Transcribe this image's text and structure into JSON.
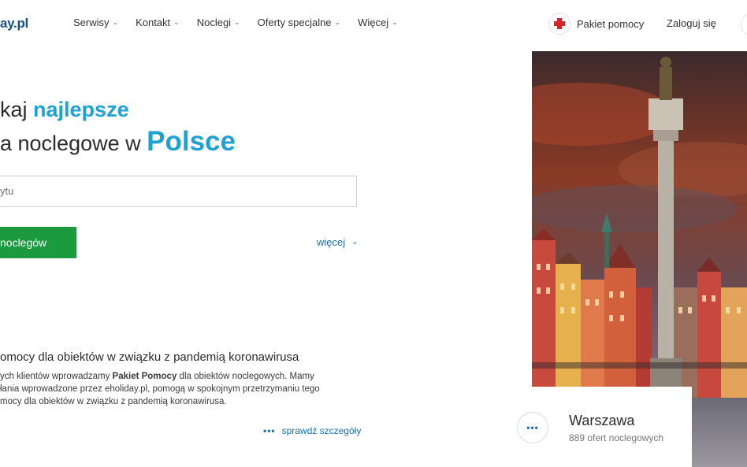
{
  "header": {
    "logo": "ay.pl",
    "nav": [
      {
        "label": "Serwisy"
      },
      {
        "label": "Kontakt"
      },
      {
        "label": "Noclegi"
      },
      {
        "label": "Oferty specjalne"
      },
      {
        "label": "Więcej"
      }
    ],
    "help_label": "Pakiet pomocy",
    "login_label": "Zaloguj się"
  },
  "hero": {
    "line1_prefix": "kaj ",
    "line1_accent": "najlepsze",
    "line2_prefix": "a noclegowe w ",
    "line2_accent": "Polsce"
  },
  "search": {
    "placeholder": "ytu",
    "button_label": "noclegów",
    "more_label": "więcej"
  },
  "info": {
    "title": "omocy dla obiektów w związku z pandemią koronawirusa",
    "line1_a": "ych klientów wprowadzamy ",
    "line1_bold": "Pakiet Pomocy",
    "line1_b": " dla obiektów noclegowych. Mamy",
    "line2": "łania wprowadzone przez eholiday.pl, pomogą w spokojnym przetrzymaniu tego",
    "line3": "mocy dla obiektów w związku z pandemią koronawirusa.",
    "details_label": "sprawdź szczegóły"
  },
  "featured": {
    "city": "Warszawa",
    "count": "889 ofert noclegowych",
    "more_icon": "more-dots-icon"
  },
  "colors": {
    "accent": "#1ea2d6",
    "button": "#1b9a3f",
    "link": "#1a6fb0",
    "logo": "#1a4f8b"
  }
}
